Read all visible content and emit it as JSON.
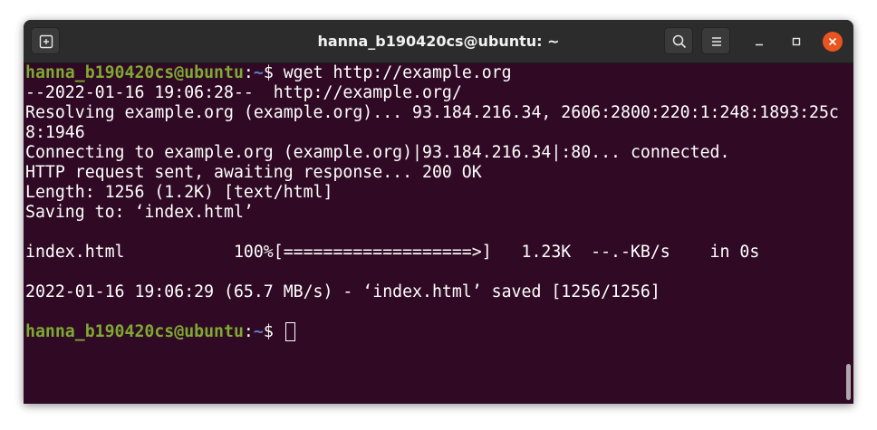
{
  "window": {
    "title": "hanna_b190420cs@ubuntu: ~"
  },
  "titlebar": {
    "icons": {
      "new_tab": "new-tab-icon",
      "search": "search-icon",
      "menu": "hamburger-menu-icon",
      "minimize": "minimize-icon",
      "maximize": "maximize-icon",
      "close": "close-icon"
    }
  },
  "colors": {
    "terminal_bg": "#300a24",
    "prompt_user": "#7ea933",
    "prompt_path": "#5b7ec9",
    "close_button": "#e95420"
  },
  "terminal": {
    "prompt_1": {
      "user": "hanna_b190420cs@ubuntu",
      "colon": ":",
      "path": "~",
      "symbol": "$ ",
      "command": "wget http://example.org"
    },
    "output": [
      "--2022-01-16 19:06:28--  http://example.org/",
      "Resolving example.org (example.org)... 93.184.216.34, 2606:2800:220:1:248:1893:25c",
      "8:1946",
      "Connecting to example.org (example.org)|93.184.216.34|:80... connected.",
      "HTTP request sent, awaiting response... 200 OK",
      "Length: 1256 (1.2K) [text/html]",
      "Saving to: ‘index.html’",
      "",
      "index.html           100%[===================>]   1.23K  --.-KB/s    in 0s",
      "",
      "2022-01-16 19:06:29 (65.7 MB/s) - ‘index.html’ saved [1256/1256]",
      ""
    ],
    "prompt_2": {
      "user": "hanna_b190420cs@ubuntu",
      "colon": ":",
      "path": "~",
      "symbol": "$ ",
      "command": ""
    }
  }
}
